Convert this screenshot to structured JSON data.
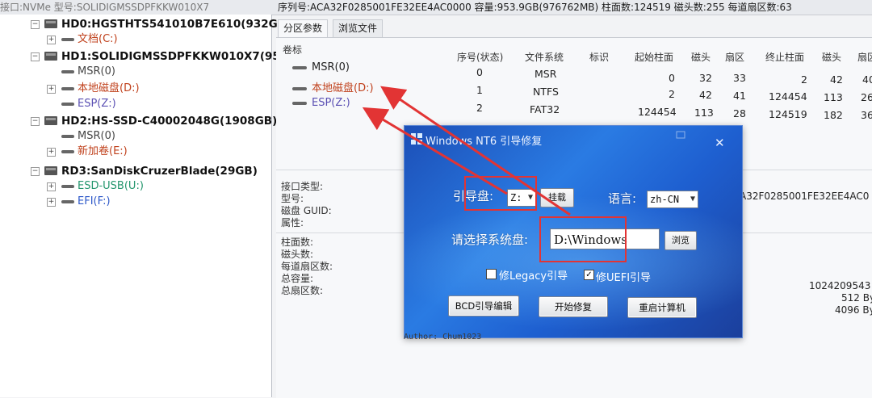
{
  "topbar": {
    "faded_text": "接口:NVMe  型号:SOLIDIGMSSDPFKKW010X7",
    "info": "序列号:ACA32F0285001FE32EE4AC0000  容量:953.9GB(976762MB)  柱面数:124519  磁头数:255  每道扇区数:63"
  },
  "tree": {
    "disks": [
      {
        "label": "HD0:HGSTHTS541010B7E610(932G"
      },
      {
        "label": "HD1:SOLIDIGMSSDPFKKW010X7(95"
      },
      {
        "label": "HD2:HS-SSD-C40002048G(1908GB)"
      },
      {
        "label": "RD3:SanDiskCruzerBlade(29GB)"
      }
    ],
    "partitions": [
      {
        "label": "文档(C:)"
      },
      {
        "label": "MSR(0)"
      },
      {
        "label": "本地磁盘(D:)"
      },
      {
        "label": "ESP(Z:)"
      },
      {
        "label": "MSR(0)"
      },
      {
        "label": "新加卷(E:)"
      },
      {
        "label": "ESD-USB(U:)"
      },
      {
        "label": "EFI(F:)"
      }
    ]
  },
  "tabs": [
    "分区参数",
    "浏览文件"
  ],
  "table": {
    "headers": [
      "卷标",
      "序号(状态)",
      "文件系统",
      "标识",
      "起始柱面",
      "磁头",
      "扇区",
      "终止柱面",
      "磁头",
      "扇区"
    ],
    "rows": [
      {
        "name": "MSR(0)",
        "idx": "0",
        "fs": "MSR",
        "start_cyl": "0",
        "head1": "32",
        "sec1": "33",
        "end_cyl": "2",
        "head2": "42",
        "sec2": "40"
      },
      {
        "name": "本地磁盘(D:)",
        "idx": "1",
        "fs": "NTFS",
        "start_cyl": "2",
        "head1": "42",
        "sec1": "41",
        "end_cyl": "124454",
        "head2": "113",
        "sec2": "26"
      },
      {
        "name": "ESP(Z:)",
        "idx": "2",
        "fs": "FAT32",
        "start_cyl": "124454",
        "head1": "113",
        "sec1": "28",
        "end_cyl": "124519",
        "head2": "182",
        "sec2": "36"
      }
    ]
  },
  "props": {
    "interface": "接口类型:",
    "model": "型号:",
    "guid": "磁盘 GUID:",
    "attr": "属性:",
    "cyl": "柱面数:",
    "heads": "磁头数:",
    "spt": "每道扇区数:",
    "total_cap": "总容量:",
    "total_sec": "总扇区数:",
    "guid_value": "A32F0285001FE32EE4AC0",
    "r1": "1024209543",
    "r2": "512 By",
    "r3": "4096 By"
  },
  "dialog": {
    "title": "Windows NT6 引导修复",
    "boot_disk_label": "引导盘:",
    "boot_disk_value": "Z:",
    "mount_button": "挂载",
    "lang_label": "语言:",
    "lang_value": "zh-CN",
    "sys_disk_label": "请选择系统盘:",
    "sys_disk_value": "D:\\Windows",
    "browse_button": "浏览",
    "legacy_label": "修Legacy引导",
    "legacy_checked": false,
    "uefi_label": "修UEFI引导",
    "uefi_checked": true,
    "bcd_button": "BCD引导编辑",
    "start_button": "开始修复",
    "restart_button": "重启计算机",
    "author": "Author: Chum1023"
  },
  "colors": {
    "annotation_red": "#e23434",
    "dialog_blue": "#2a7be3",
    "partition_orange": "#c0411c",
    "partition_purple": "#5a4fb3",
    "partition_teal": "#23966d"
  }
}
